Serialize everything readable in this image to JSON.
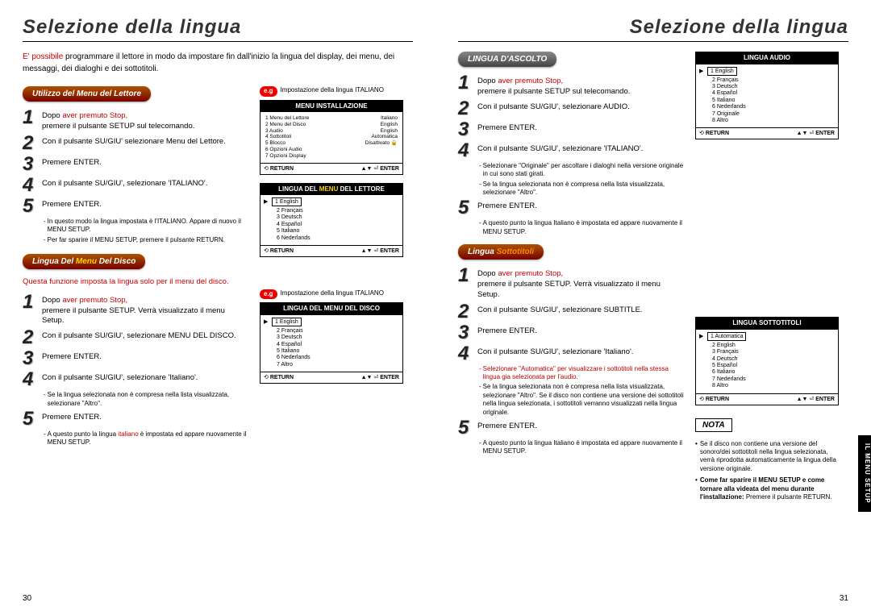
{
  "left": {
    "title": "Selezione della lingua",
    "intro_1": "E' possibile",
    "intro_2": " programmare il lettore in modo da impostare fin dall'inizio la lingua del display, dei menu, dei messaggi, dei dialoghi e dei sottotitoli.",
    "sec1": {
      "pill": "Utilizzo del Menu del Lettore",
      "s1a": "Dopo ",
      "s1b": "aver premuto Stop,",
      "s1c": "premere il pulsante SETUP sul telecomando.",
      "s2": "Con il pulsante SU/GIU' selezionare Menu del Lettore.",
      "s3": "Premere ENTER.",
      "s4": "Con il pulsante SU/GIU', selezionare 'ITALIANO'.",
      "s5": "Premere ENTER.",
      "n1": "In questo modo la lingua impostata è l'ITALIANO. Appare di nuovo il MENU SETUP.",
      "n2": "Per far sparire il MENU SETUP, premere il pulsante RETURN."
    },
    "sec2": {
      "pill_a": "Lingua Del ",
      "pill_b": "Menu",
      "pill_c": " Del Disco",
      "desc": "Questa funzione imposta la lingua solo per il menu del disco.",
      "s1a": "Dopo ",
      "s1b": "aver premuto Stop,",
      "s1c": "premere il pulsante SETUP. Verrà visualizzato il menu Setup.",
      "s2": "Con il pulsante SU/GIU', selezionare MENU DEL DISCO.",
      "s3": "Premere ENTER.",
      "s4": "Con il pulsante SU/GIU', selezionare 'Italiano'.",
      "n1": "Se la lingua selezionata non è compresa nella lista visualizzata, selezionare \"Altro\".",
      "s5": "Premere ENTER.",
      "n2a": "A questo punto la lingua ",
      "n2b": "italiano",
      "n2c": " è impostata ed appare nuovamente il MENU SETUP."
    },
    "eg1_label": "Impostazione della lingua ITALIANO",
    "eg2_label": "Impostazione della lingua ITALIANO",
    "scr1": {
      "hdr": "MENU INSTALLAZIONE",
      "rows": [
        [
          "1 Menu del Lettore",
          "Italiano"
        ],
        [
          "2 Menu del Disco",
          "English"
        ],
        [
          "3 Audio",
          "English"
        ],
        [
          "4 Sottotitoli",
          "Automatica"
        ],
        [
          "5 Blocco",
          "Disattivato 🔒"
        ],
        [
          "6 Opzioni Audio",
          ""
        ],
        [
          "7 Opzioni Display",
          ""
        ]
      ]
    },
    "scr2": {
      "hdr_a": "LINGUA DEL ",
      "hdr_b": "MENU",
      "hdr_c": " DEL LETTORE",
      "sel": "1 English",
      "items": [
        "2 Français",
        "3 Deutsch",
        "4 Español",
        "5 Italiano",
        "6 Nederlands"
      ]
    },
    "scr3": {
      "hdr": "LINGUA DEL MENU DEL DISCO",
      "sel": "1 English",
      "items": [
        "2 Français",
        "3 Deutsch",
        "4 Español",
        "5 Italiano",
        "6 Nederlands",
        "7 Altro"
      ]
    },
    "foot_return": "RETURN",
    "foot_enter": "ENTER",
    "pagenum": "30"
  },
  "right": {
    "title": "Selezione della lingua",
    "sec1": {
      "pill": "LINGUA D'ASCOLTO",
      "s1a": "Dopo ",
      "s1b": "aver premuto Stop,",
      "s1c": "premere il pulsante SETUP sul telecomando.",
      "s2": "Con il pulsante SU/GIU', selezionare AUDIO.",
      "s3": "Premere ENTER.",
      "s4": "Con il pulsante SU/GIU', selezionare 'ITALIANO'.",
      "n1": "Selezionare \"Originale\" per ascoltare i dialoghi nella versione originale in cui sono stati girati.",
      "n2": "Se la lingua selezionata non è compresa nella lista visualizzata, selezionare \"Altro\".",
      "s5": "Premere ENTER.",
      "n3": "A questo punto la lingua Italiano è impostata ed appare nuovamente il MENU SETUP."
    },
    "sec2": {
      "pill_a": "Lingua ",
      "pill_b": "Sottotitoli",
      "s1a": "Dopo ",
      "s1b": "aver premuto Stop,",
      "s1c": "premere il pulsante SETUP. Verrà visualizzato il menu Setup.",
      "s2": "Con il pulsante SU/GIU', selezionare SUBTITLE.",
      "s3": "Premere ENTER.",
      "s4": "Con il pulsante SU/GIU', selezionare 'Italiano'.",
      "n1": "Selezionare \"Automatica\" per visualizzare i sottotitoli nella stessa lingua gia selezionata per l'audio.",
      "n2": "Se la lingua selezionata non è compresa nella lista visualizzata, selezionare \"Altro\". Se il disco non contiene una versione dei sottotitoli nella lingua selezionata, i sottotitoli verranno visualizzati nella lingua originale.",
      "s5": "Premere ENTER.",
      "n3": "A questo punto la lingua Italiano è impostata ed appare nuovamente il MENU SETUP."
    },
    "scr1": {
      "hdr": "LINGUA AUDIO",
      "sel": "1 English",
      "items": [
        "2 Français",
        "3 Deutsch",
        "4 Español",
        "5 Italiano",
        "6 Nederlands",
        "7 Originale",
        "8 Altro"
      ]
    },
    "scr2": {
      "hdr": "LINGUA SOTTOTITOLI",
      "sel": "1 Automatica",
      "items": [
        "2 English",
        "3 Français",
        "4 Deutsch",
        "5 Español",
        "6 Italiano",
        "7 Nederlands",
        "8 Altro"
      ]
    },
    "nota_label": "NOTA",
    "nota_b1": "Se il disco non contiene una versione del sonoro/dei sottotitoli nella lingua selezionata, verrà riprodotta automaticamente la lingua della versione originale.",
    "nota_b2a": "Come far sparire il MENU SETUP e come tornare alla videata del menu durante l'installazione: ",
    "nota_b2b": "Premere il pulsante RETURN.",
    "pagenum": "31",
    "sidetab": "IL MENU SETUP"
  }
}
